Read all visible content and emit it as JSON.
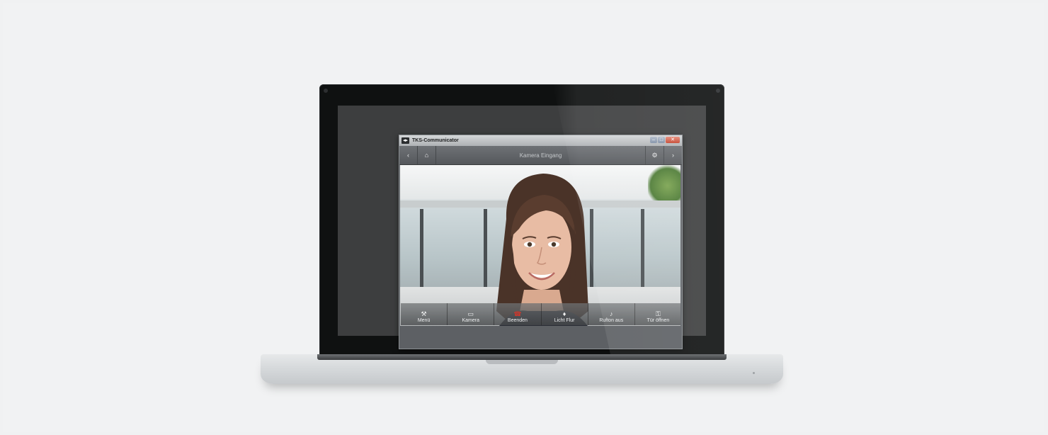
{
  "window": {
    "title": "TKS-Communicator",
    "app_icon": "tks-app-icon",
    "controls": {
      "minimize": "–",
      "maximize": "□",
      "close": "✕"
    }
  },
  "toolbar": {
    "back_icon": "‹",
    "camera_icon": "⌂",
    "title": "Kamera Eingang",
    "settings_icon": "⚙",
    "forward_icon": "›"
  },
  "actions": [
    {
      "label": "Menü",
      "icon": "wrench-icon",
      "glyph": "⚒"
    },
    {
      "label": "Kamera",
      "icon": "camera-icon",
      "glyph": "▭"
    },
    {
      "label": "Beenden",
      "icon": "hangup-icon",
      "glyph": "☎"
    },
    {
      "label": "Licht Flur",
      "icon": "light-icon",
      "glyph": "♦"
    },
    {
      "label": "Rufton aus",
      "icon": "mute-icon",
      "glyph": "♪"
    },
    {
      "label": "Tür öffnen",
      "icon": "key-icon",
      "glyph": "⚿"
    }
  ],
  "colors": {
    "close_red": "#c4442d",
    "hangup_red": "#d0372b",
    "tree_green": "#4c7a34"
  }
}
